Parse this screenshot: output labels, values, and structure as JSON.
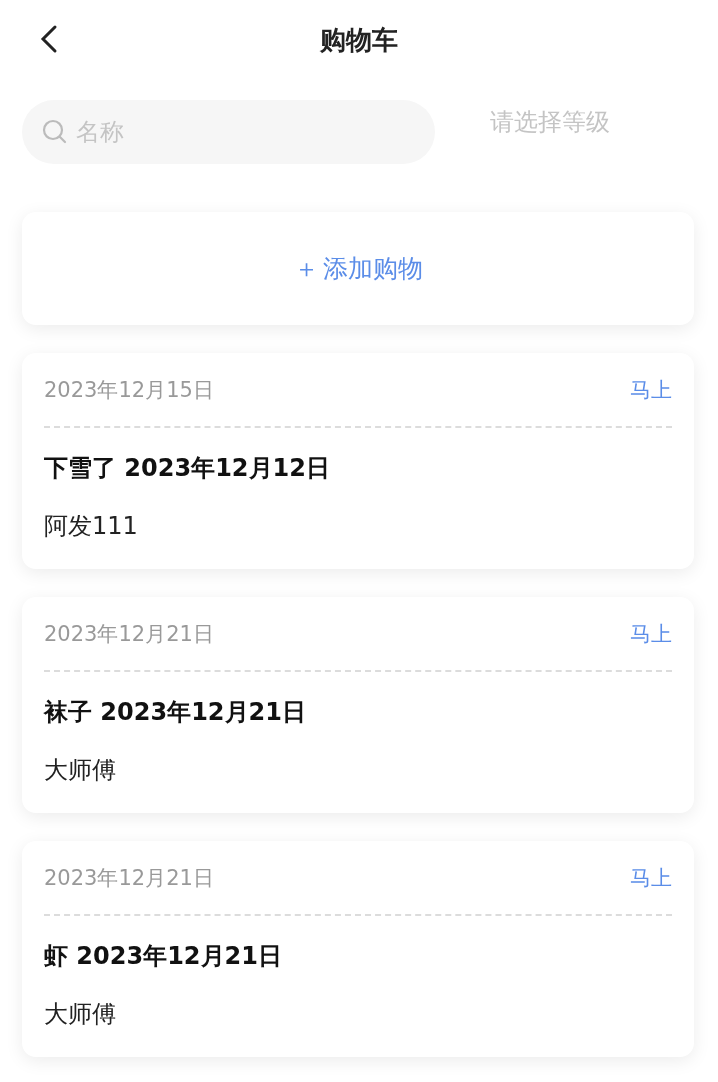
{
  "header": {
    "title": "购物车"
  },
  "search": {
    "placeholder": "名称"
  },
  "level_select": {
    "placeholder": "请选择等级"
  },
  "add_button": {
    "icon": "＋",
    "label": "添加购物"
  },
  "items": [
    {
      "date": "2023年12月15日",
      "action": "马上",
      "title": "下雪了 2023年12月12日",
      "subtitle": "阿发111"
    },
    {
      "date": "2023年12月21日",
      "action": "马上",
      "title": "袜子 2023年12月21日",
      "subtitle": "大师傅"
    },
    {
      "date": "2023年12月21日",
      "action": "马上",
      "title": "虾 2023年12月21日",
      "subtitle": "大师傅"
    }
  ]
}
